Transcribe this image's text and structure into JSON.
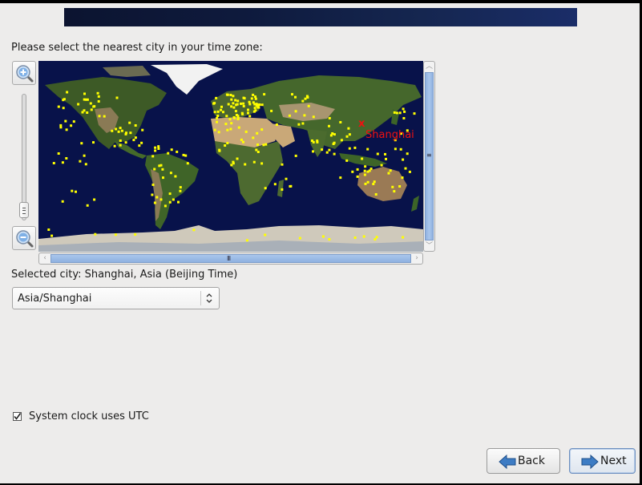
{
  "header": {
    "banner": "anaconda-header-banner"
  },
  "prompt": "Please select the nearest city in your time zone:",
  "map": {
    "zoom_in_icon": "zoom-in-icon",
    "zoom_out_icon": "zoom-out-icon",
    "selected_marker": {
      "label": "Shanghai",
      "symbol": "x",
      "color": "#ee1111"
    },
    "city_dot_color": "#ffff00",
    "ocean_color": "#08124a"
  },
  "selected_city_label": "Selected city: Shanghai, Asia (Beijing Time)",
  "timezone_combo": {
    "value": "Asia/Shanghai"
  },
  "utc_checkbox": {
    "label": "System clock uses UTC",
    "checked": true,
    "mark": "✓"
  },
  "buttons": {
    "back": "Back",
    "next": "Next"
  }
}
